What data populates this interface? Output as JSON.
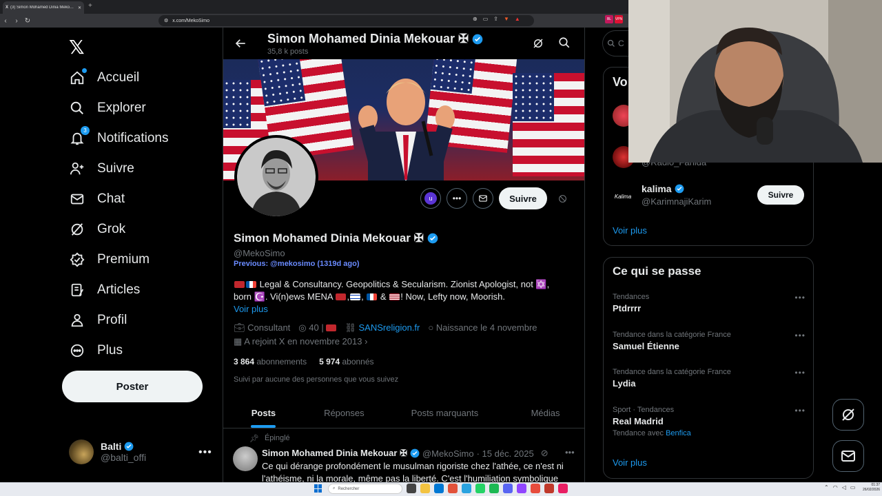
{
  "browser": {
    "tab_title": "(3) Simon Mohamed Dinia Meko…",
    "tab_badge": "X",
    "url": "x.com/MekoSimo",
    "ext_labels": [
      "BL",
      "VPN"
    ]
  },
  "nav": {
    "items": [
      {
        "label": "Accueil",
        "icon": "home-icon"
      },
      {
        "label": "Explorer",
        "icon": "search-icon"
      },
      {
        "label": "Notifications",
        "icon": "bell-icon",
        "badge": "3"
      },
      {
        "label": "Suivre",
        "icon": "person-add-icon"
      },
      {
        "label": "Chat",
        "icon": "mail-icon"
      },
      {
        "label": "Grok",
        "icon": "grok-icon"
      },
      {
        "label": "Premium",
        "icon": "verified-icon"
      },
      {
        "label": "Articles",
        "icon": "article-icon"
      },
      {
        "label": "Profil",
        "icon": "person-icon"
      },
      {
        "label": "Plus",
        "icon": "more-circle-icon"
      }
    ],
    "post_button": "Poster",
    "account": {
      "name": "Balti",
      "handle": "@balti_offi"
    }
  },
  "profile": {
    "header_name": "Simon Mohamed Dinia Mekouar ✠",
    "header_posts": "35,8 k posts",
    "name": "Simon Mohamed Dinia Mekouar ✠",
    "handle": "@MekoSimo",
    "previous": "Previous: @mekosimo (1319d ago)",
    "bio_line1": "Legal & Consultancy. Geopolitics & Secularism. Zionist Apologist, not ✡️,",
    "bio_line2_a": "born ☪️. Vi(n)ews MENA",
    "bio_line2_b": "! Now, Lefty now, Moorish.",
    "voir_plus": "Voir plus",
    "job": "Consultant",
    "age": "40 |",
    "website": "SANSreligion.fr",
    "birth": "Naissance le 4 novembre",
    "joined": "A rejoint X en novembre 2013",
    "following_count": "3 864",
    "following_label": "abonnements",
    "followers_count": "5 974",
    "followers_label": "abonnés",
    "followed_by": "Suivi par aucune des personnes que vous suivez",
    "follow_button": "Suivre",
    "action_u": "u"
  },
  "tabs": [
    "Posts",
    "Réponses",
    "Posts marquants",
    "Médias"
  ],
  "pinned_tweet": {
    "pinned_label": "Épinglé",
    "author": "Simon Mohamed Dinia Mekouar ✠",
    "handle": "@MekoSimo",
    "date": "· 15 déc. 2025",
    "text": "Ce qui dérange profondément le musulman rigoriste chez l'athée, ce n'est ni l'athéisme, ni la morale, même pas la liberté. C'est l'humiliation symbolique"
  },
  "right": {
    "search_placeholder": "C",
    "who_title": "Vo",
    "radio_handle": "@Radio_Fahida",
    "suggest": {
      "name": "kalima",
      "handle": "@KarimnajiKarim",
      "button": "Suivre",
      "avatar_text": "Kalima"
    },
    "who_more": "Voir plus",
    "trends_title": "Ce qui se passe",
    "trends": [
      {
        "context": "Tendances",
        "name": "Ptdrrrr"
      },
      {
        "context": "Tendance dans la catégorie France",
        "name": "Samuel Étienne"
      },
      {
        "context": "Tendance dans la catégorie France",
        "name": "Lydia"
      },
      {
        "context": "Sport · Tendances",
        "name": "Real Madrid",
        "sub": "Tendance avec",
        "sub_link": "Benfica"
      }
    ],
    "trends_more": "Voir plus"
  },
  "taskbar": {
    "search": "Rechercher",
    "time": "01:37",
    "date": "26/02/2026"
  }
}
